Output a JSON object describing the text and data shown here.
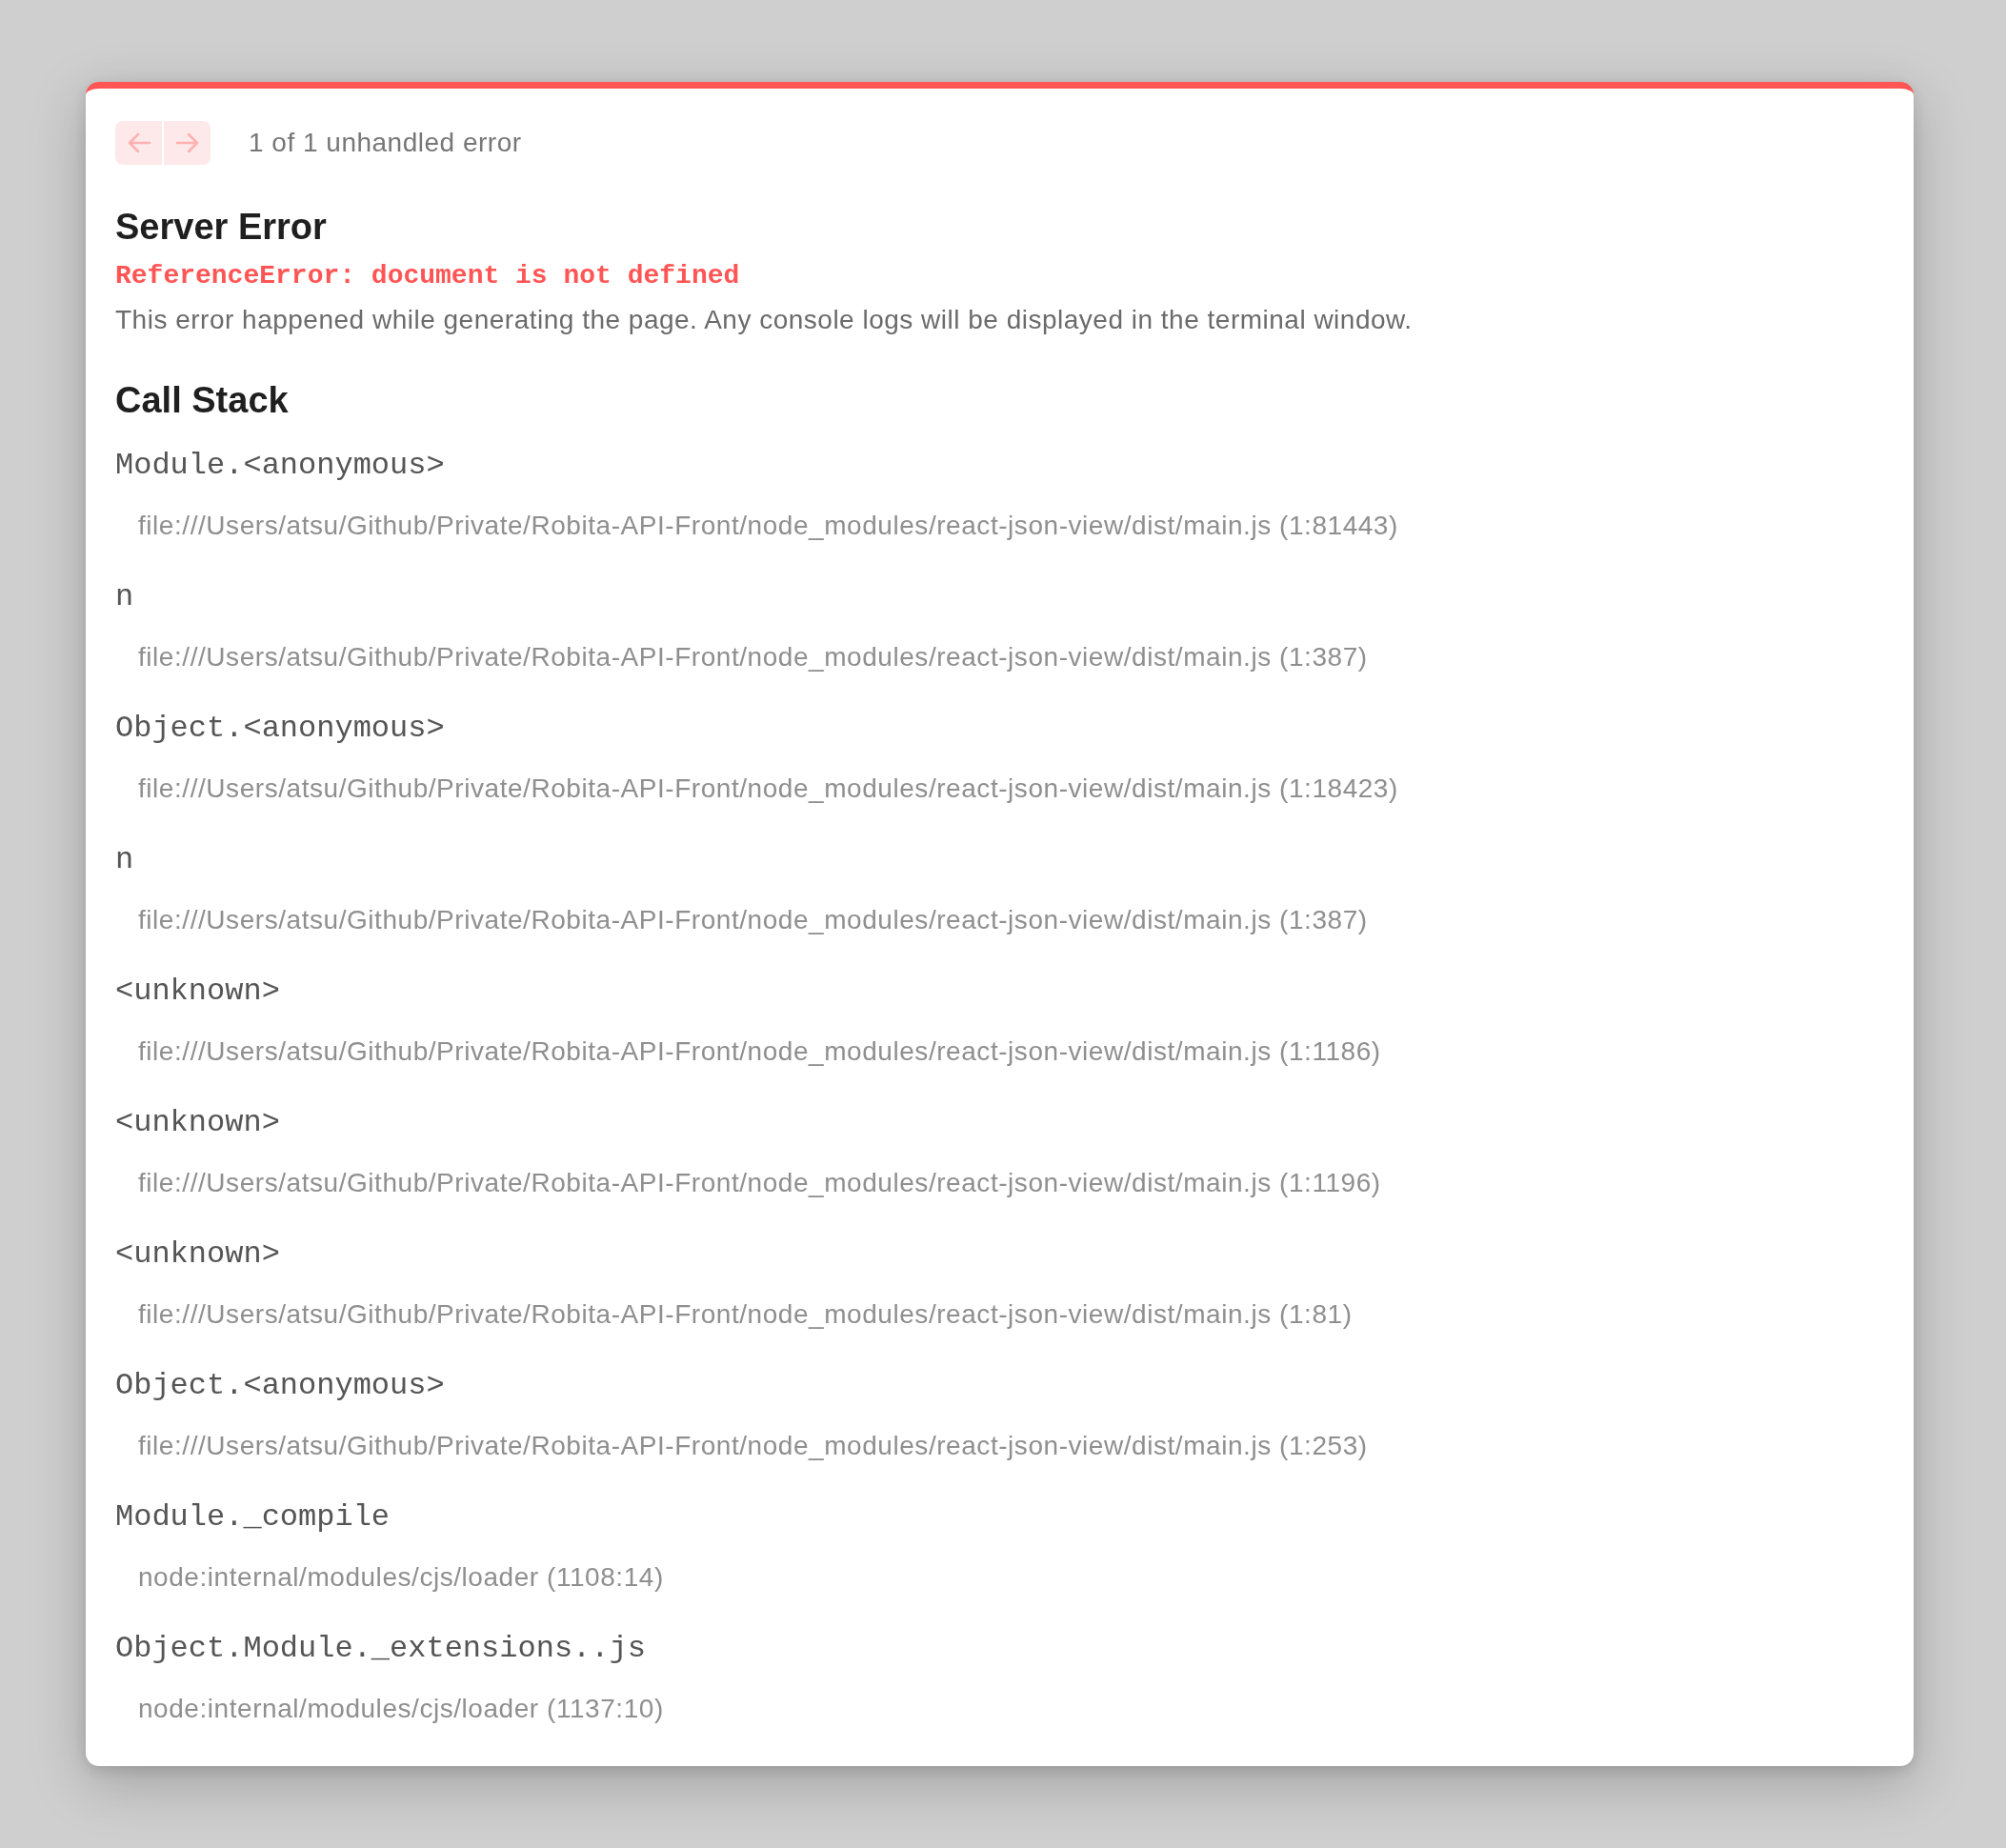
{
  "error_overlay": {
    "nav": {
      "buttons": [
        {
          "kind": "previous",
          "disabled": true
        },
        {
          "kind": "next",
          "disabled": true
        }
      ],
      "counter": "1 of 1 unhandled error"
    },
    "title": "Server Error",
    "error_message": "ReferenceError: document is not defined",
    "description": "This error happened while generating the page. Any console logs will be displayed in the terminal window.",
    "call_stack": {
      "title": "Call Stack",
      "frames": [
        {
          "function": "Module.<anonymous>",
          "location": "file:///Users/atsu/Github/Private/Robita-API-Front/node_modules/react-json-view/dist/main.js (1:81443)"
        },
        {
          "function": "n",
          "location": "file:///Users/atsu/Github/Private/Robita-API-Front/node_modules/react-json-view/dist/main.js (1:387)"
        },
        {
          "function": "Object.<anonymous>",
          "location": "file:///Users/atsu/Github/Private/Robita-API-Front/node_modules/react-json-view/dist/main.js (1:18423)"
        },
        {
          "function": "n",
          "location": "file:///Users/atsu/Github/Private/Robita-API-Front/node_modules/react-json-view/dist/main.js (1:387)"
        },
        {
          "function": "<unknown>",
          "location": "file:///Users/atsu/Github/Private/Robita-API-Front/node_modules/react-json-view/dist/main.js (1:1186)"
        },
        {
          "function": "<unknown>",
          "location": "file:///Users/atsu/Github/Private/Robita-API-Front/node_modules/react-json-view/dist/main.js (1:1196)"
        },
        {
          "function": "<unknown>",
          "location": "file:///Users/atsu/Github/Private/Robita-API-Front/node_modules/react-json-view/dist/main.js (1:81)"
        },
        {
          "function": "Object.<anonymous>",
          "location": "file:///Users/atsu/Github/Private/Robita-API-Front/node_modules/react-json-view/dist/main.js (1:253)"
        },
        {
          "function": "Module._compile",
          "location": "node:internal/modules/cjs/loader (1108:14)"
        },
        {
          "function": "Object.Module._extensions..js",
          "location": "node:internal/modules/cjs/loader (1137:10)"
        }
      ]
    }
  }
}
